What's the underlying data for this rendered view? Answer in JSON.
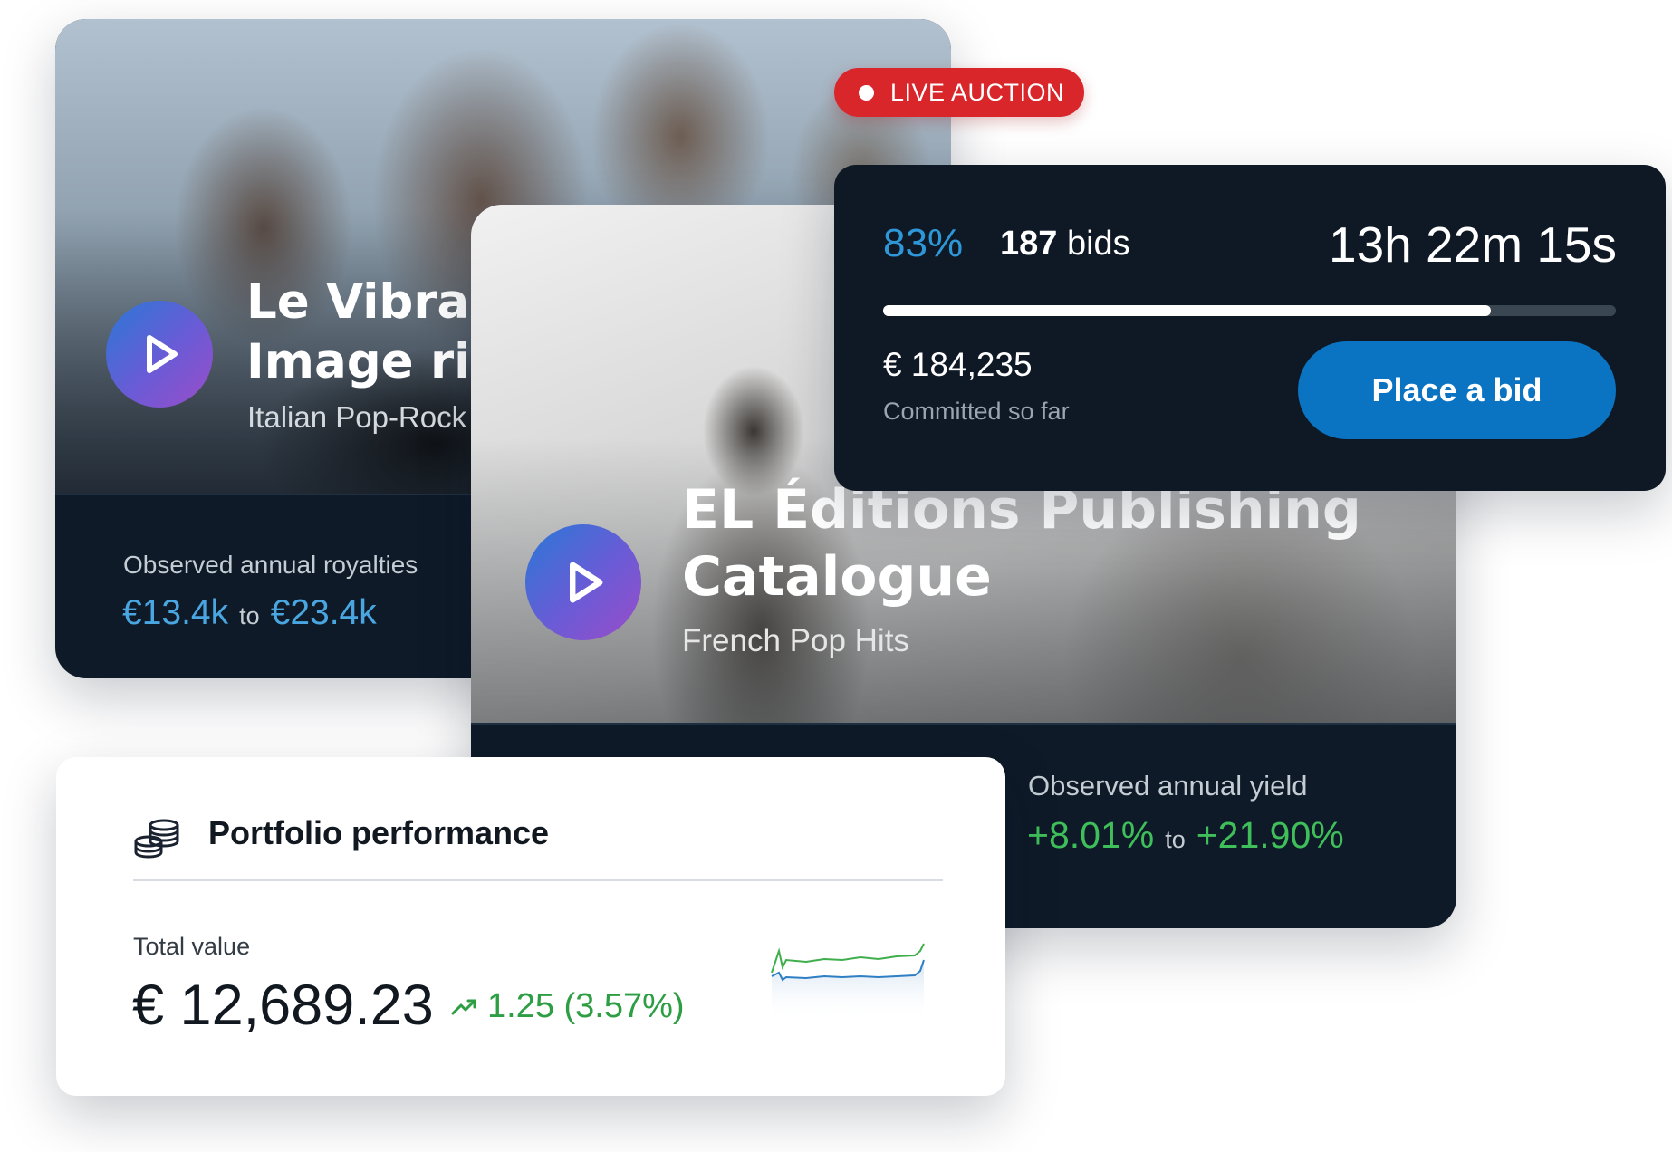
{
  "cards": [
    {
      "title": "Le Vibrazioni\nImage rights",
      "subtitle": "Italian Pop-Rock",
      "metric_label": "Observed annual royalties",
      "metric_from": "€13.4k",
      "metric_to": "€23.4k",
      "metric_joiner": "to"
    },
    {
      "title": "EL Éditions Publishing\nCatalogue",
      "subtitle": "French Pop Hits",
      "metric_label": "Observed annual yield",
      "metric_from": "+8.01%",
      "metric_to": "+21.90%",
      "metric_joiner": "to"
    }
  ],
  "live_badge": {
    "label": "LIVE AUCTION"
  },
  "auction": {
    "percent_label": "83%",
    "progress": 0.83,
    "bids_count": "187",
    "bids_word": "bids",
    "time_left": "13h 22m 15s",
    "committed_amount": "€ 184,235",
    "committed_label": "Committed so far",
    "bid_button": "Place a bid"
  },
  "portfolio": {
    "title": "Portfolio performance",
    "total_label": "Total value",
    "total_value": "€ 12,689.23",
    "change": "1.25 (3.57%)"
  },
  "icons": {
    "play": "play-icon",
    "coins": "coins-stack-icon",
    "trend": "trend-up-icon"
  },
  "colors": {
    "accent_blue": "#0b74c2",
    "live_red": "#d9262b",
    "positive_green": "#2e9e44",
    "card_dark": "#0e1a28"
  }
}
